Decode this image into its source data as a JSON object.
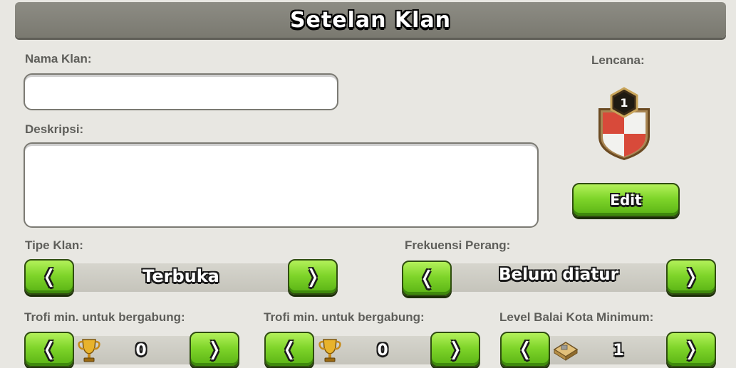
{
  "header": {
    "title": "Setelan Klan"
  },
  "name_field": {
    "label": "Nama Klan:",
    "value": "",
    "placeholder": ""
  },
  "description_field": {
    "label": "Deskripsi:",
    "value": "",
    "placeholder": ""
  },
  "badge": {
    "label": "Lencana:",
    "level": "1",
    "icon": "clan-badge-icon",
    "edit_label": "Edit"
  },
  "clan_type": {
    "label": "Tipe Klan:",
    "value": "Terbuka",
    "prev": "❬",
    "next": "❭"
  },
  "war_frequency": {
    "label": "Frekuensi Perang:",
    "value": "Belum diatur",
    "prev": "❬",
    "next": "❭"
  },
  "min_trophies": {
    "label": "Trofi min. untuk bergabung:",
    "value": "0",
    "icon": "trophy-icon",
    "prev": "❬",
    "next": "❭"
  },
  "min_builder_trophies": {
    "label": "Trofi min. untuk bergabung:",
    "value": "0",
    "icon": "trophy-icon",
    "prev": "❬",
    "next": "❭"
  },
  "min_townhall": {
    "label": "Level Balai Kota Minimum:",
    "value": "1",
    "icon": "town-hall-icon",
    "prev": "❬",
    "next": "❭"
  },
  "colors": {
    "accent_green": "#7fd52a",
    "header_gray": "#8d8c84",
    "panel_bg": "#e8e7e2"
  }
}
